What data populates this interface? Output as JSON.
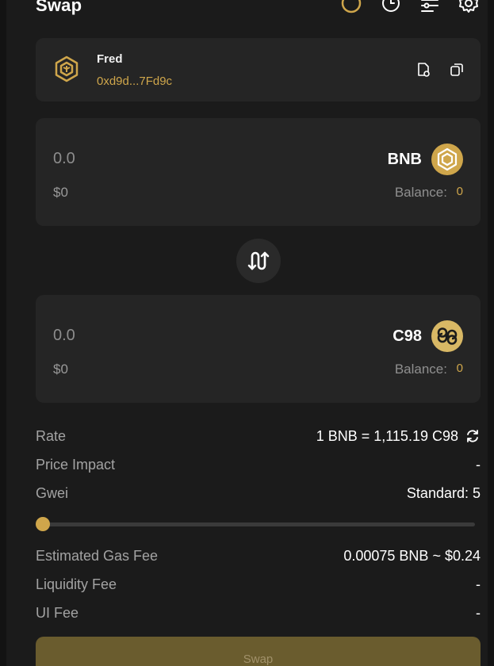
{
  "header": {
    "title": "Swap",
    "icons": [
      "loading-ring-icon",
      "history-icon",
      "filter-icon",
      "gear-icon"
    ]
  },
  "wallet": {
    "name": "Fred",
    "address": "0xd9d...7Fd9c",
    "logo": "bnb-chain-icon",
    "actions": [
      "copy-file-icon",
      "copy-icon"
    ]
  },
  "from": {
    "amount": "0.0",
    "usd": "$0",
    "symbol": "BNB",
    "balance_label": "Balance:",
    "balance_value": "0",
    "logo": "bnb-icon"
  },
  "to": {
    "amount": "0.0",
    "usd": "$0",
    "symbol": "C98",
    "balance_label": "Balance:",
    "balance_value": "0",
    "logo": "c98-icon"
  },
  "details": {
    "rate_label": "Rate",
    "rate_value": "1 BNB = 1,115.19 C98",
    "price_impact_label": "Price Impact",
    "price_impact_value": "-",
    "gwei_label": "Gwei",
    "gwei_value": "Standard: 5",
    "gwei_slider_fraction": 0.0,
    "gas_fee_label": "Estimated Gas Fee",
    "gas_fee_value": "0.00075 BNB ~ $0.24",
    "liquidity_fee_label": "Liquidity Fee",
    "liquidity_fee_value": "-",
    "ui_fee_label": "UI Fee",
    "ui_fee_value": "-"
  },
  "actions": {
    "swap_label": "Swap"
  },
  "colors": {
    "accent": "#cfa64b",
    "background": "#1b1b1b",
    "card": "#252525",
    "button_disabled": "#6a5c2e"
  }
}
